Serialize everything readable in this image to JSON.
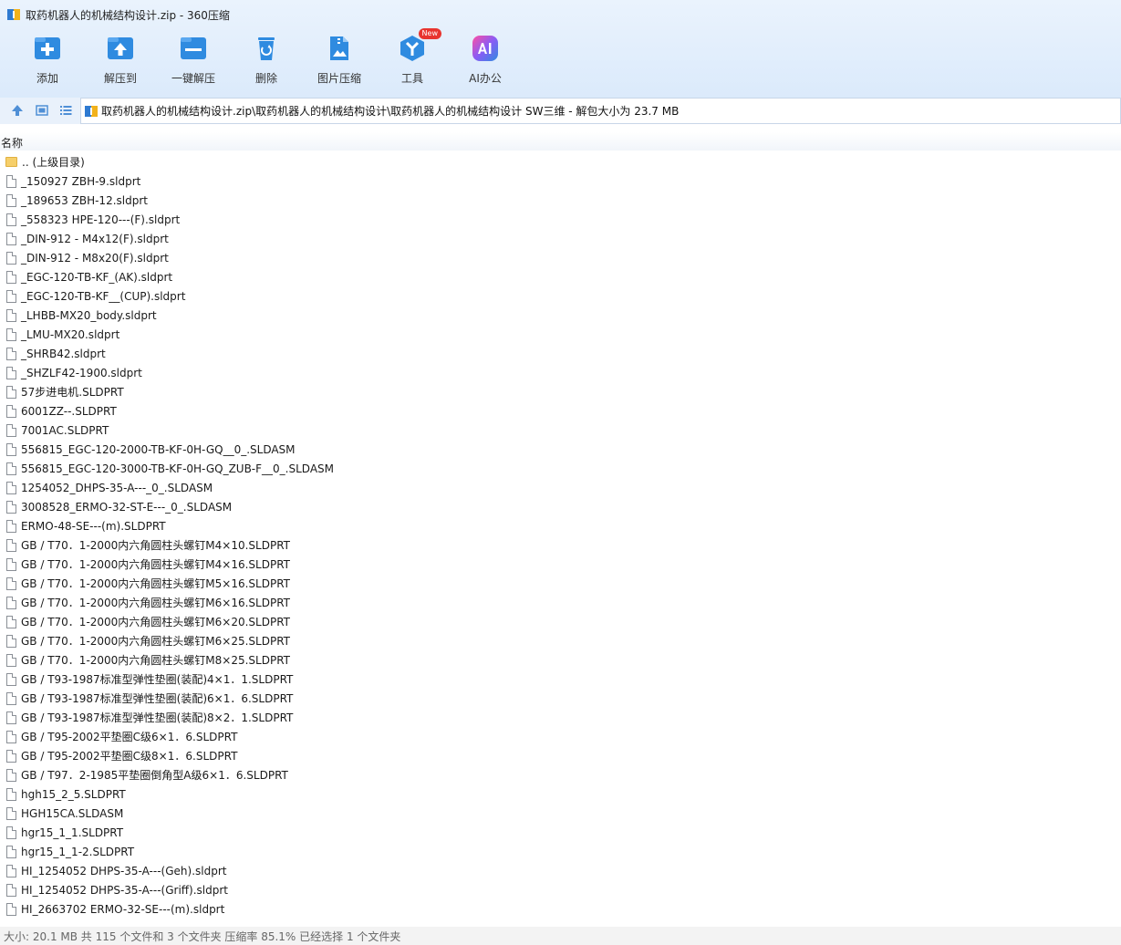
{
  "window": {
    "title": "取药机器人的机械结构设计.zip - 360压缩"
  },
  "toolbar": {
    "items": [
      {
        "label": "添加",
        "icon": "add-icon"
      },
      {
        "label": "解压到",
        "icon": "extract-to-icon"
      },
      {
        "label": "一键解压",
        "icon": "one-click-extract-icon"
      },
      {
        "label": "删除",
        "icon": "delete-icon"
      },
      {
        "label": "图片压缩",
        "icon": "image-compress-icon"
      },
      {
        "label": "工具",
        "icon": "tools-icon",
        "badge": "New"
      },
      {
        "label": "AI办公",
        "icon": "ai-office-icon"
      }
    ]
  },
  "nav": {
    "up_icon": "up-arrow-icon",
    "view_icon": "thumbnail-view-icon",
    "list_icon": "list-view-icon"
  },
  "address": {
    "path": "取药机器人的机械结构设计.zip\\取药机器人的机械结构设计\\取药机器人的机械结构设计 SW三维 - 解包大小为 23.7 MB"
  },
  "columns": {
    "name": "名称"
  },
  "files": [
    {
      "name": ".. (上级目录)",
      "type": "folder"
    },
    {
      "name": "_150927 ZBH-9.sldprt",
      "type": "file"
    },
    {
      "name": "_189653 ZBH-12.sldprt",
      "type": "file"
    },
    {
      "name": "_558323 HPE-120---(F).sldprt",
      "type": "file"
    },
    {
      "name": "_DIN-912 - M4x12(F).sldprt",
      "type": "file"
    },
    {
      "name": "_DIN-912 - M8x20(F).sldprt",
      "type": "file"
    },
    {
      "name": "_EGC-120-TB-KF_(AK).sldprt",
      "type": "file"
    },
    {
      "name": "_EGC-120-TB-KF__(CUP).sldprt",
      "type": "file"
    },
    {
      "name": "_LHBB-MX20_body.sldprt",
      "type": "file"
    },
    {
      "name": "_LMU-MX20.sldprt",
      "type": "file"
    },
    {
      "name": "_SHRB42.sldprt",
      "type": "file"
    },
    {
      "name": "_SHZLF42-1900.sldprt",
      "type": "file"
    },
    {
      "name": "57步进电机.SLDPRT",
      "type": "file"
    },
    {
      "name": "6001ZZ--.SLDPRT",
      "type": "file"
    },
    {
      "name": "7001AC.SLDPRT",
      "type": "file"
    },
    {
      "name": "556815_EGC-120-2000-TB-KF-0H-GQ__0_.SLDASM",
      "type": "file"
    },
    {
      "name": "556815_EGC-120-3000-TB-KF-0H-GQ_ZUB-F__0_.SLDASM",
      "type": "file"
    },
    {
      "name": "1254052_DHPS-35-A---_0_.SLDASM",
      "type": "file"
    },
    {
      "name": "3008528_ERMO-32-ST-E---_0_.SLDASM",
      "type": "file"
    },
    {
      "name": "ERMO-48-SE---(m).SLDPRT",
      "type": "file"
    },
    {
      "name": "GB / T70．1-2000内六角圆柱头螺钉M4×10.SLDPRT",
      "type": "file"
    },
    {
      "name": "GB / T70．1-2000内六角圆柱头螺钉M4×16.SLDPRT",
      "type": "file"
    },
    {
      "name": "GB / T70．1-2000内六角圆柱头螺钉M5×16.SLDPRT",
      "type": "file"
    },
    {
      "name": "GB / T70．1-2000内六角圆柱头螺钉M6×16.SLDPRT",
      "type": "file"
    },
    {
      "name": "GB / T70．1-2000内六角圆柱头螺钉M6×20.SLDPRT",
      "type": "file"
    },
    {
      "name": "GB / T70．1-2000内六角圆柱头螺钉M6×25.SLDPRT",
      "type": "file"
    },
    {
      "name": "GB / T70．1-2000内六角圆柱头螺钉M8×25.SLDPRT",
      "type": "file"
    },
    {
      "name": "GB / T93-1987标准型弹性垫圈(装配)4×1．1.SLDPRT",
      "type": "file"
    },
    {
      "name": "GB / T93-1987标准型弹性垫圈(装配)6×1．6.SLDPRT",
      "type": "file"
    },
    {
      "name": "GB / T93-1987标准型弹性垫圈(装配)8×2．1.SLDPRT",
      "type": "file"
    },
    {
      "name": "GB / T95-2002平垫圈C级6×1．6.SLDPRT",
      "type": "file"
    },
    {
      "name": "GB / T95-2002平垫圈C级8×1．6.SLDPRT",
      "type": "file"
    },
    {
      "name": "GB / T97．2-1985平垫圈倒角型A级6×1．6.SLDPRT",
      "type": "file"
    },
    {
      "name": "hgh15_2_5.SLDPRT",
      "type": "file"
    },
    {
      "name": "HGH15CA.SLDASM",
      "type": "file"
    },
    {
      "name": "hgr15_1_1.SLDPRT",
      "type": "file"
    },
    {
      "name": "hgr15_1_1-2.SLDPRT",
      "type": "file"
    },
    {
      "name": "HI_1254052 DHPS-35-A---(Geh).sldprt",
      "type": "file"
    },
    {
      "name": "HI_1254052 DHPS-35-A---(Griff).sldprt",
      "type": "file"
    },
    {
      "name": "HI_2663702 ERMO-32-SE---(m).sldprt",
      "type": "file"
    }
  ],
  "status": {
    "text": "大小: 20.1 MB 共 115 个文件和 3 个文件夹 压缩率 85.1% 已经选择 1 个文件夹"
  },
  "colors": {
    "accent": "#2f8be0",
    "toolbar_bg": "#dbeafb",
    "badge": "#e8342f"
  }
}
